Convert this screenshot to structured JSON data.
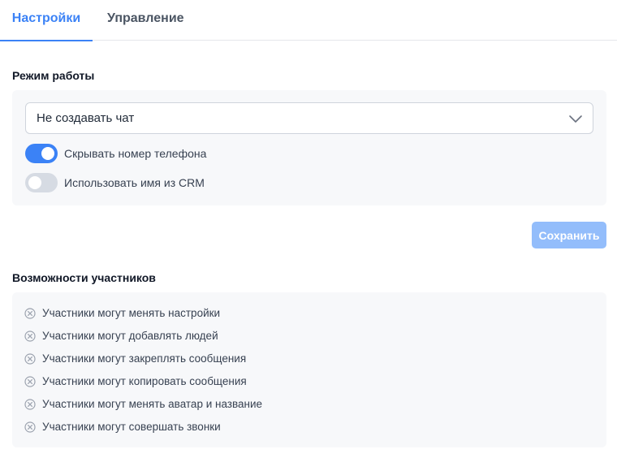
{
  "tabs": [
    {
      "label": "Настройки",
      "active": true
    },
    {
      "label": "Управление",
      "active": false
    }
  ],
  "mode": {
    "title": "Режим работы",
    "select_value": "Не создавать чат",
    "toggles": [
      {
        "label": "Скрывать номер телефона",
        "on": true
      },
      {
        "label": "Использовать имя из CRM",
        "on": false
      }
    ]
  },
  "save_label": "Сохранить",
  "permissions": {
    "title": "Возможности участников",
    "items": [
      {
        "label": "Участники могут менять настройки",
        "icon": "x-circle-icon"
      },
      {
        "label": "Участники могут добавлять людей",
        "icon": "x-circle-icon"
      },
      {
        "label": "Участники могут закреплять сообщения",
        "icon": "x-circle-icon"
      },
      {
        "label": "Участники могут копировать сообщения",
        "icon": "x-circle-icon"
      },
      {
        "label": "Участники могут менять аватар и название",
        "icon": "x-circle-icon"
      },
      {
        "label": "Участники могут совершать звонки",
        "icon": "x-circle-icon"
      }
    ]
  },
  "colors": {
    "accent": "#3b82f6",
    "save_disabled": "#93bdfb",
    "panel_bg": "#f7f8fa"
  }
}
